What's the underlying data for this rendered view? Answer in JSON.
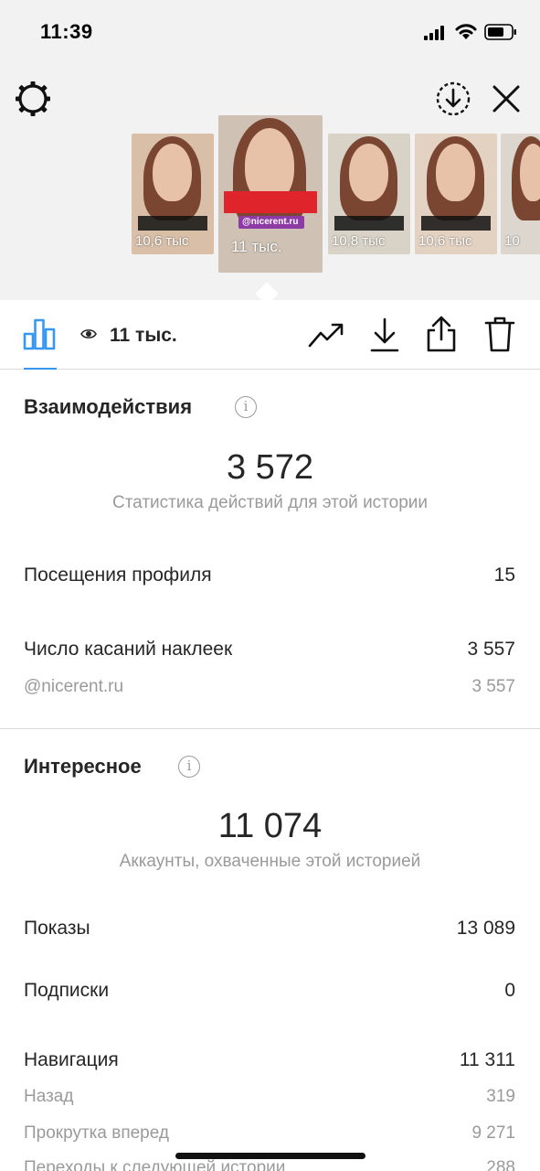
{
  "status_bar": {
    "time": "11:39"
  },
  "stories": [
    {
      "views": "10,6 тыс"
    },
    {
      "views": "11 тыс."
    },
    {
      "views": "10,8 тыс"
    },
    {
      "views": "10,6 тыс"
    },
    {
      "views": "10"
    }
  ],
  "selected_story": {
    "sticker_tag": "@nicerent.ru"
  },
  "toolbar": {
    "views": "11 тыс."
  },
  "interactions": {
    "title": "Взаимодействия",
    "total": "3 572",
    "total_caption": "Статистика действий для этой истории",
    "rows": [
      {
        "label": "Посещения профиля",
        "value": "15"
      },
      {
        "label": "Число касаний наклеек",
        "value": "3 557"
      }
    ],
    "sub_rows": [
      {
        "label": "@nicerent.ru",
        "value": "3 557"
      }
    ]
  },
  "discovery": {
    "title": "Интересное",
    "total": "11 074",
    "total_caption": "Аккаунты, охваченные этой историей",
    "rows": [
      {
        "label": "Показы",
        "value": "13 089"
      },
      {
        "label": "Подписки",
        "value": "0"
      },
      {
        "label": "Навигация",
        "value": "11 311"
      }
    ],
    "sub_rows": [
      {
        "label": "Назад",
        "value": "319"
      },
      {
        "label": "Прокрутка вперед",
        "value": "9 271"
      },
      {
        "label": "Переходы к следующей истории",
        "value": "288"
      }
    ]
  },
  "colors": {
    "accent": "#3797f0",
    "muted": "#9a9a9a",
    "divider": "#dbdbdb"
  }
}
